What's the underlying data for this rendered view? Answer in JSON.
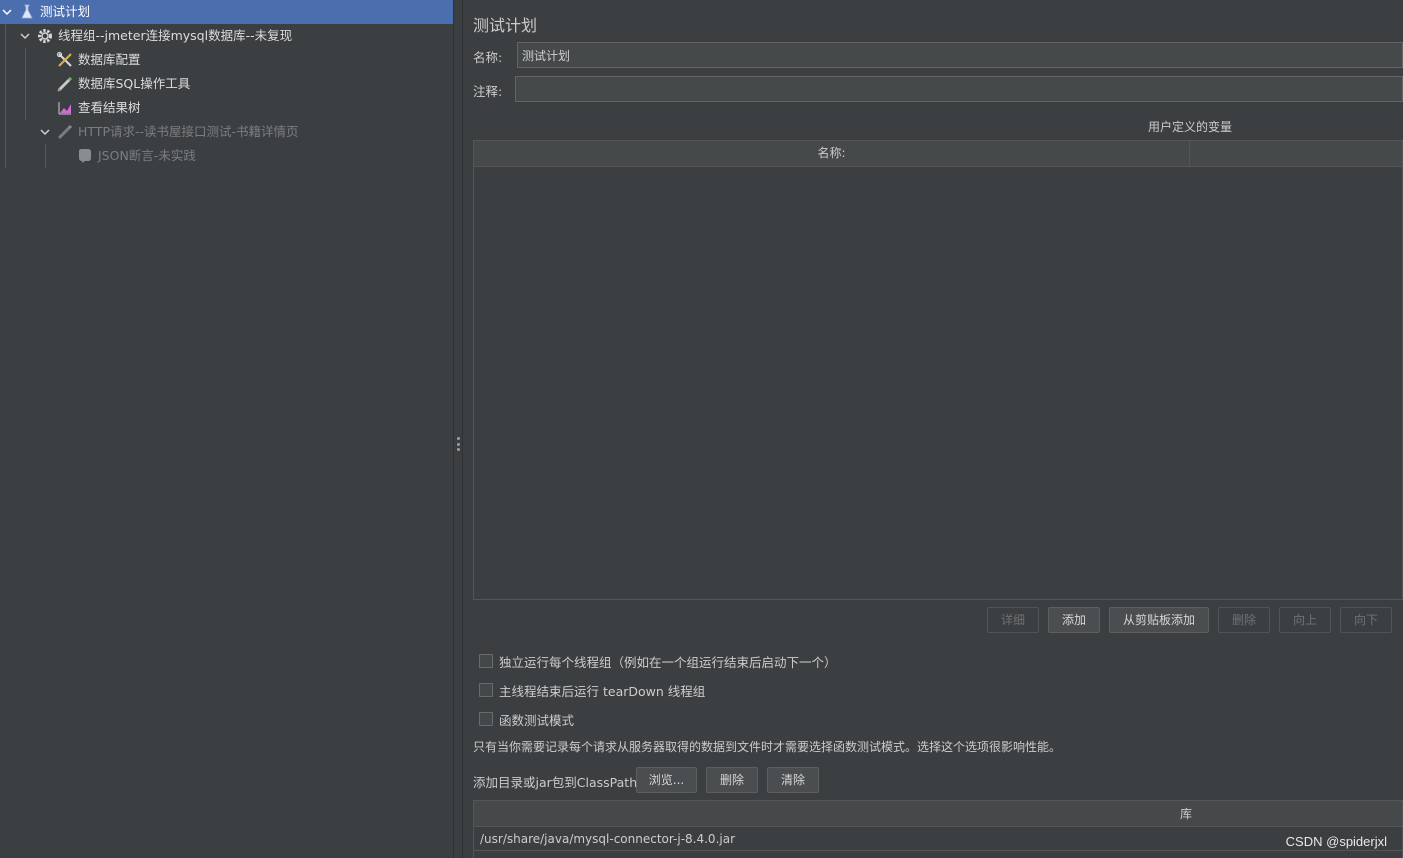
{
  "tree": {
    "items": [
      {
        "label": "测试计划",
        "icon": "test-plan-icon"
      },
      {
        "label": "线程组--jmeter连接mysql数据库--未复现",
        "icon": "gear-icon"
      },
      {
        "label": "数据库配置",
        "icon": "config-tools-icon"
      },
      {
        "label": "数据库SQL操作工具",
        "icon": "sampler-pen-icon"
      },
      {
        "label": "查看结果树",
        "icon": "result-tree-icon"
      },
      {
        "label": "HTTP请求--读书屋接口测试-书籍详情页",
        "icon": "sampler-pen-icon"
      },
      {
        "label": "JSON断言-未实践",
        "icon": "assertion-icon"
      }
    ]
  },
  "panel": {
    "title": "测试计划",
    "name_label": "名称:",
    "name_value": "测试计划",
    "comment_label": "注释:",
    "comment_value": "",
    "variables_title": "用户定义的变量",
    "variables_header_name": "名称:",
    "buttons": {
      "detail": "详细",
      "add": "添加",
      "add_from_clipboard": "从剪贴板添加",
      "delete": "删除",
      "up": "向上",
      "down": "向下"
    },
    "checkboxes": [
      {
        "label": "独立运行每个线程组（例如在一个组运行结束后启动下一个）",
        "checked": false
      },
      {
        "label": "主线程结束后运行 tearDown 线程组",
        "checked": false
      },
      {
        "label": "函数测试模式",
        "checked": false
      }
    ],
    "note": "只有当你需要记录每个请求从服务器取得的数据到文件时才需要选择函数测试模式。选择这个选项很影响性能。",
    "classpath_label": "添加目录或jar包到ClassPath",
    "classpath_buttons": {
      "browse": "浏览...",
      "delete": "删除",
      "clear": "清除"
    },
    "library_header": "库",
    "libraries": [
      "/usr/share/java/mysql-connector-j-8.4.0.jar"
    ]
  },
  "watermark": "CSDN @spiderjxl",
  "colors": {
    "selected": "#4b6eaf",
    "background": "#3c3f41"
  }
}
